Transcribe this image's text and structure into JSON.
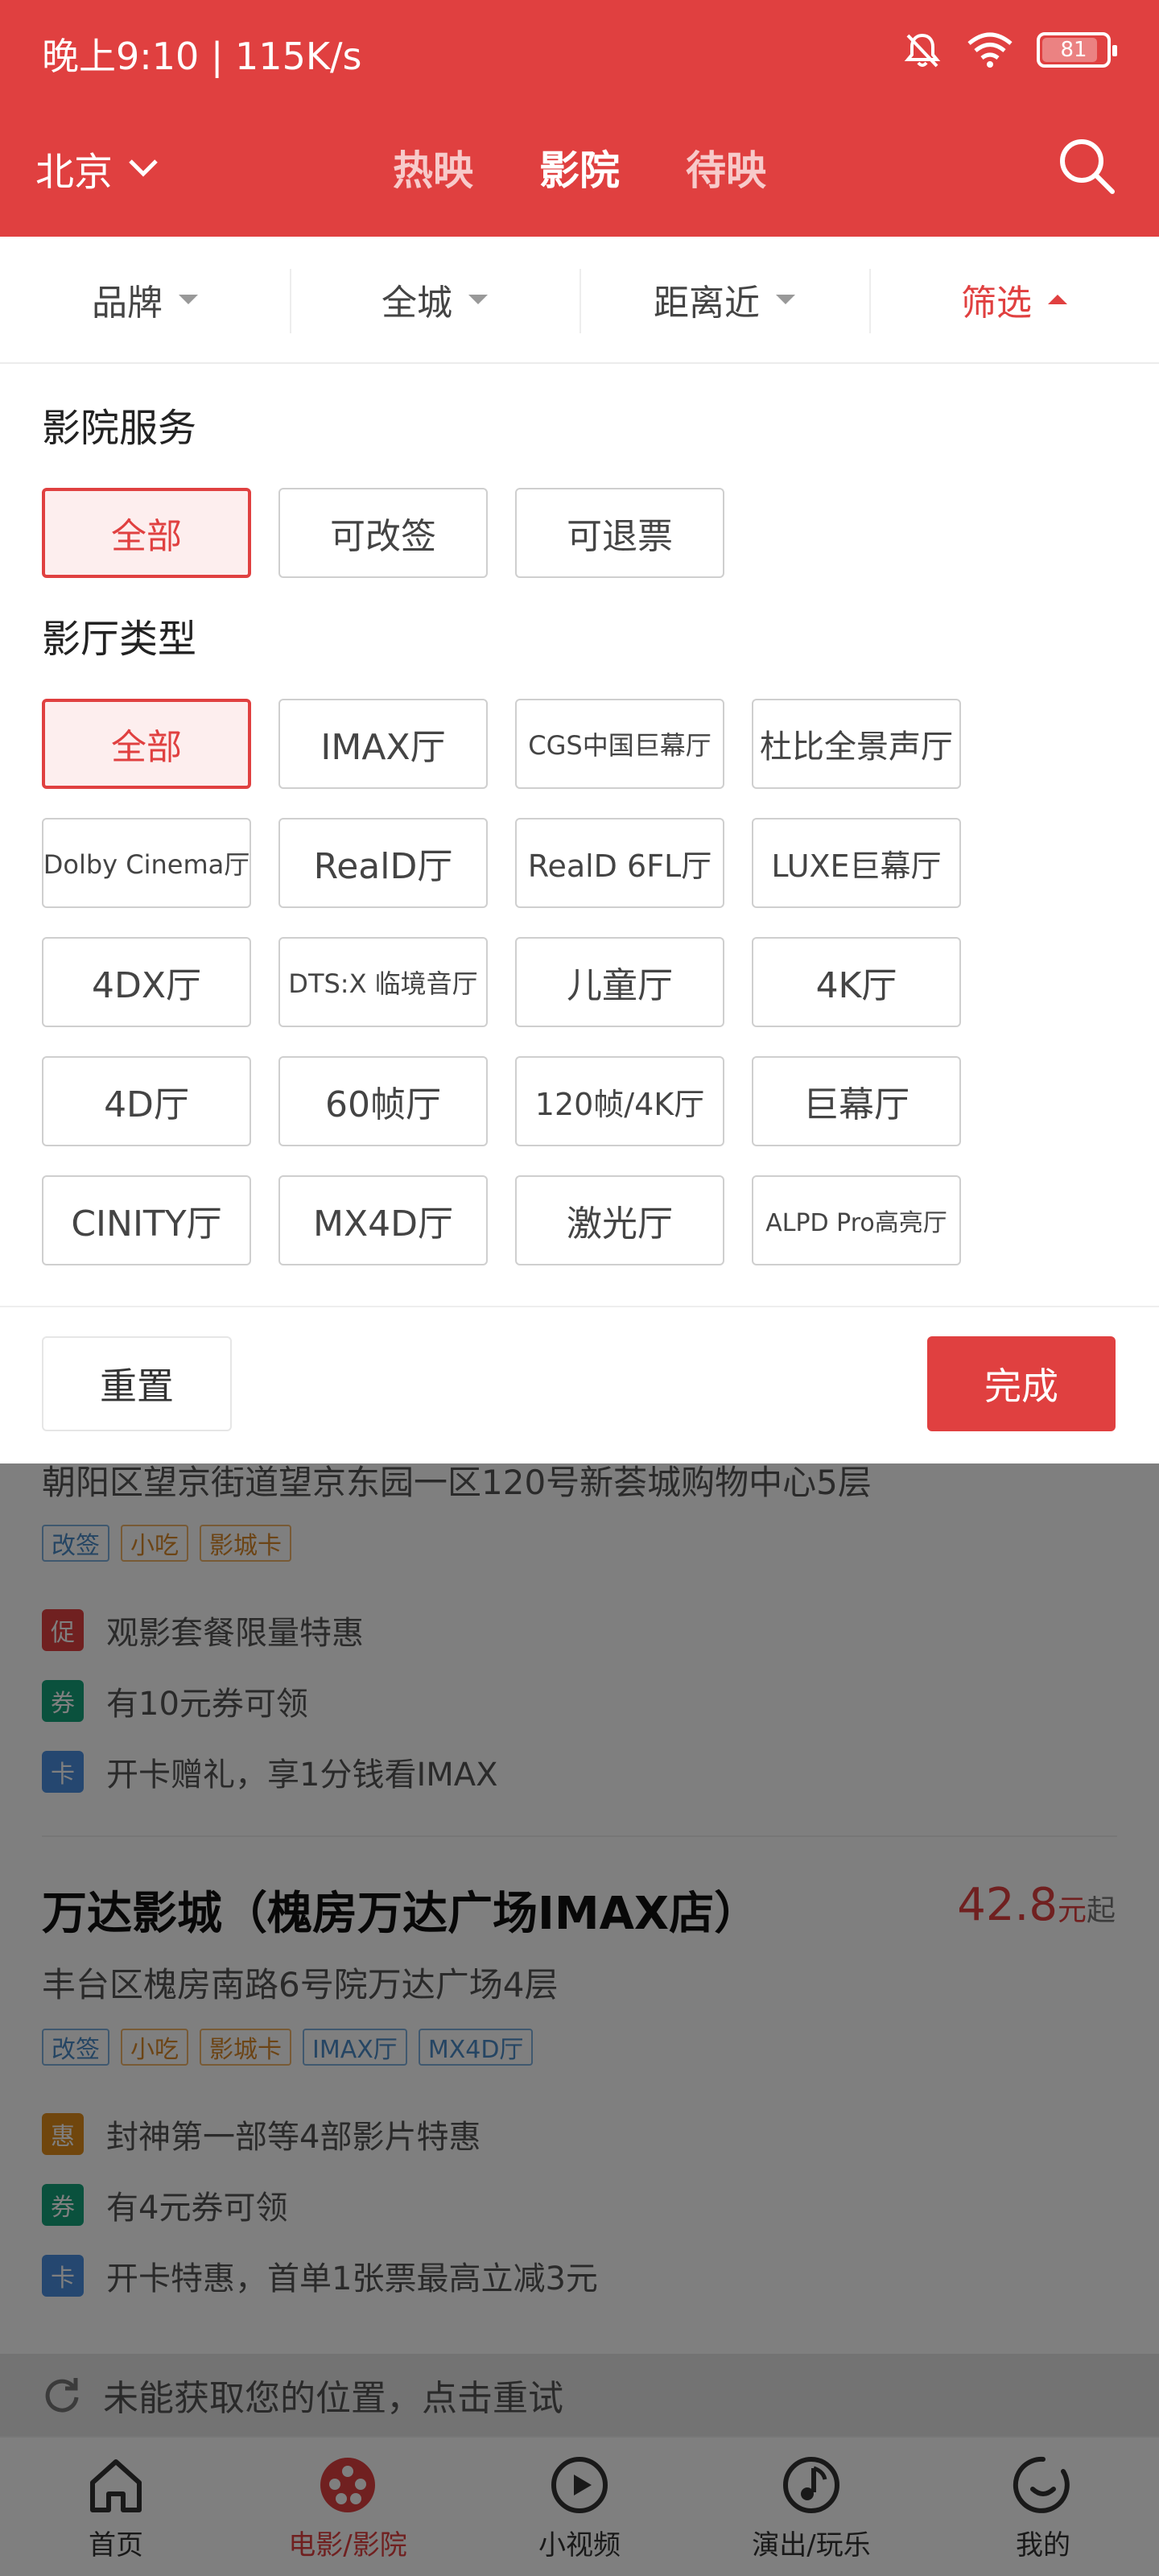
{
  "status_bar": {
    "time": "晚上9:10 | 115K/s",
    "battery": "81"
  },
  "header": {
    "city": "北京",
    "tabs": [
      {
        "label": "热映"
      },
      {
        "label": "影院"
      },
      {
        "label": "待映"
      }
    ],
    "active_tab": "影院",
    "brand_color": "#e04040"
  },
  "filters": [
    {
      "label": "品牌"
    },
    {
      "label": "全城"
    },
    {
      "label": "距离近"
    },
    {
      "label": "筛选"
    }
  ],
  "panel": {
    "service_title": "影院服务",
    "services": [
      "全部",
      "可改签",
      "可退票"
    ],
    "hall_title": "影厅类型",
    "halls": [
      "全部",
      "IMAX厅",
      "CGS中国巨幕厅",
      "杜比全景声厅",
      "Dolby Cinema厅",
      "RealD厅",
      "RealD 6FL厅",
      "LUXE巨幕厅",
      "4DX厅",
      "DTS:X 临境音厅",
      "儿童厅",
      "4K厅",
      "4D厅",
      "60帧厅",
      "120帧/4K厅",
      "巨幕厅",
      "CINITY厅",
      "MX4D厅",
      "激光厅",
      "ALPD Pro高亮厅"
    ],
    "reset_label": "重置",
    "done_label": "完成"
  },
  "cinemas": [
    {
      "address": "朝阳区望京街道望京东园一区120号新荟城购物中心5层",
      "tags": [
        "改签",
        "小吃",
        "影城卡"
      ],
      "promos": [
        {
          "badge": "促",
          "text": "观影套餐限量特惠"
        },
        {
          "badge": "券",
          "text": "有10元券可领"
        },
        {
          "badge": "卡",
          "text": "开卡赠礼，享1分钱看IMAX"
        }
      ]
    },
    {
      "name": "万达影城（槐房万达广场IMAX店）",
      "price": "42.8",
      "price_unit": "元",
      "price_suffix": "起",
      "address": "丰台区槐房南路6号院万达广场4层",
      "tags": [
        "改签",
        "小吃",
        "影城卡",
        "IMAX厅",
        "MX4D厅"
      ],
      "promos": [
        {
          "badge": "惠",
          "text": "封神第一部等4部影片特惠"
        },
        {
          "badge": "券",
          "text": "有4元券可领"
        },
        {
          "badge": "卡",
          "text": "开卡特惠，首单1张票最高立减3元"
        }
      ]
    }
  ],
  "location_notice": "未能获取您的位置，点击重试",
  "bottom_nav": [
    {
      "label": "首页",
      "icon": "home-icon"
    },
    {
      "label": "电影/影院",
      "icon": "film-reel-icon"
    },
    {
      "label": "小视频",
      "icon": "play-icon"
    },
    {
      "label": "演出/玩乐",
      "icon": "music-note-icon"
    },
    {
      "label": "我的",
      "icon": "profile-icon"
    }
  ]
}
